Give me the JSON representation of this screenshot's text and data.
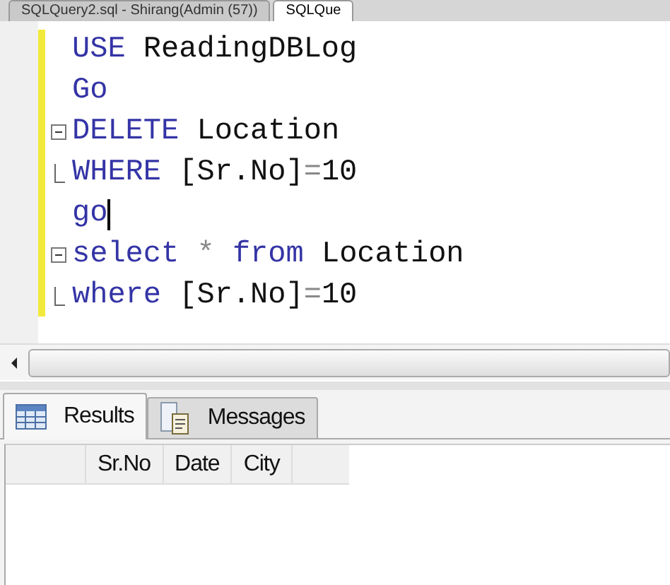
{
  "editor_tabs": [
    {
      "label": "SQLQuery2.sql - Shirang(Admin (57))",
      "selected": false
    },
    {
      "label": "SQLQue",
      "selected": true
    }
  ],
  "code_lines": [
    {
      "kind": "plain",
      "modified": true,
      "caret": false,
      "tokens": [
        {
          "kind": "keyword",
          "text": "USE"
        },
        {
          "kind": "plain",
          "text": " ReadingDBLog"
        }
      ]
    },
    {
      "kind": "plain",
      "modified": true,
      "caret": false,
      "tokens": [
        {
          "kind": "keyword",
          "text": "Go"
        }
      ]
    },
    {
      "kind": "foldstart",
      "modified": true,
      "caret": false,
      "tokens": [
        {
          "kind": "keyword",
          "text": "DELETE"
        },
        {
          "kind": "plain",
          "text": " Location"
        }
      ]
    },
    {
      "kind": "foldend",
      "modified": true,
      "caret": false,
      "tokens": [
        {
          "kind": "keyword",
          "text": "WHERE"
        },
        {
          "kind": "plain",
          "text": " [Sr.No]"
        },
        {
          "kind": "operator",
          "text": "="
        },
        {
          "kind": "plain",
          "text": "10"
        }
      ]
    },
    {
      "kind": "plain",
      "modified": true,
      "caret": true,
      "tokens": [
        {
          "kind": "keyword",
          "text": "go"
        }
      ]
    },
    {
      "kind": "foldstart",
      "modified": true,
      "caret": false,
      "tokens": [
        {
          "kind": "keyword",
          "text": "select"
        },
        {
          "kind": "operator",
          "text": " * "
        },
        {
          "kind": "keyword",
          "text": "from"
        },
        {
          "kind": "plain",
          "text": " Location"
        }
      ]
    },
    {
      "kind": "foldend",
      "modified": true,
      "caret": false,
      "tokens": [
        {
          "kind": "keyword",
          "text": "where"
        },
        {
          "kind": "plain",
          "text": " [Sr.No]"
        },
        {
          "kind": "operator",
          "text": "="
        },
        {
          "kind": "plain",
          "text": "10"
        }
      ]
    }
  ],
  "result_tabs": [
    {
      "label": "Results",
      "selected": true,
      "kind": "grid"
    },
    {
      "label": "Messages",
      "selected": false,
      "kind": "messages"
    }
  ],
  "grid": {
    "columns": [
      "Sr.No",
      "Date",
      "City"
    ]
  }
}
